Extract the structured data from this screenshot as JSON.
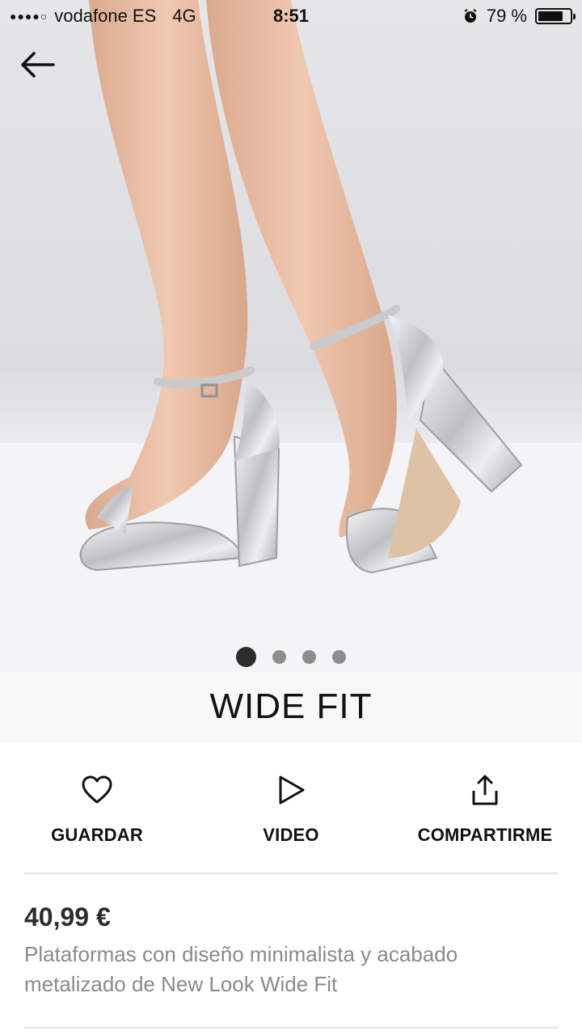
{
  "status_bar": {
    "signal": "●●●●○",
    "carrier": "vodafone ES",
    "network": "4G",
    "time": "8:51",
    "battery_percent_label": "79 %",
    "battery_level": 0.79,
    "alarm_icon": "alarm-clock-icon"
  },
  "nav": {
    "back_icon": "arrow-left-icon"
  },
  "gallery": {
    "image_count": 4,
    "active_index": 0
  },
  "product": {
    "brand": "WIDE FIT",
    "price": "40,99 €",
    "description": "Plataformas con diseño minimalista y acabado metalizado de New Look Wide Fit"
  },
  "actions": [
    {
      "label": "GUARDAR",
      "icon": "heart-icon"
    },
    {
      "label": "VIDEO",
      "icon": "play-icon"
    },
    {
      "label": "COMPARTIRME",
      "icon": "share-icon"
    }
  ],
  "colors": {
    "text": "#111111",
    "muted": "#8a8a8a",
    "brand_band": "#f8f8f8",
    "dot_active": "#2d2d2d",
    "dot_inactive": "#8d8d8d"
  }
}
